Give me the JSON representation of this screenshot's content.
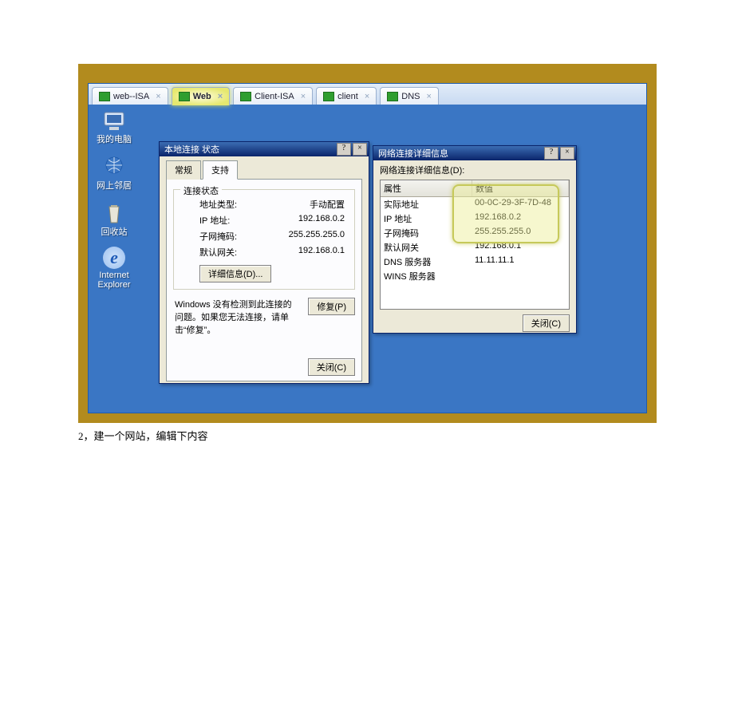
{
  "doc_caption": "2，建一个网站，编辑下内容",
  "vm_tabs": [
    {
      "label": "web--ISA",
      "active": false
    },
    {
      "label": "Web",
      "active": true
    },
    {
      "label": "Client-ISA",
      "active": false
    },
    {
      "label": "client",
      "active": false
    },
    {
      "label": "DNS",
      "active": false
    }
  ],
  "desktop_icons": [
    {
      "label": "我的电脑",
      "glyph": "🖥️"
    },
    {
      "label": "网上邻居",
      "glyph": "🌐"
    },
    {
      "label": "回收站",
      "glyph": "🗑️"
    },
    {
      "label": "Internet\nExplorer",
      "glyph": "e"
    }
  ],
  "win_status": {
    "title": "本地连接 状态",
    "help_btn": "?",
    "close_btn": "×",
    "tabs": {
      "general": "常规",
      "support": "支持"
    },
    "group_label": "连接状态",
    "rows": {
      "addr_type_label": "地址类型:",
      "addr_type_value": "手动配置",
      "ip_label": "IP 地址:",
      "ip_value": "192.168.0.2",
      "mask_label": "子网掩码:",
      "mask_value": "255.255.255.0",
      "gw_label": "默认网关:",
      "gw_value": "192.168.0.1"
    },
    "details_btn": "详细信息(D)...",
    "hint": "Windows 没有检测到此连接的问题。如果您无法连接，请单击“修复”。",
    "repair_btn": "修复(P)",
    "close_bottom": "关闭(C)"
  },
  "win_details": {
    "title": "网络连接详细信息",
    "help_btn": "?",
    "close_btn": "×",
    "list_label": "网络连接详细信息(D):",
    "col_prop": "属性",
    "col_val": "数值",
    "rows": [
      {
        "prop": "实际地址",
        "val": "00-0C-29-3F-7D-48"
      },
      {
        "prop": "IP 地址",
        "val": "192.168.0.2"
      },
      {
        "prop": "子网掩码",
        "val": "255.255.255.0"
      },
      {
        "prop": "默认网关",
        "val": "192.168.0.1"
      },
      {
        "prop": "DNS 服务器",
        "val": "11.11.11.1"
      },
      {
        "prop": "WINS 服务器",
        "val": ""
      }
    ],
    "close_bottom": "关闭(C)"
  }
}
